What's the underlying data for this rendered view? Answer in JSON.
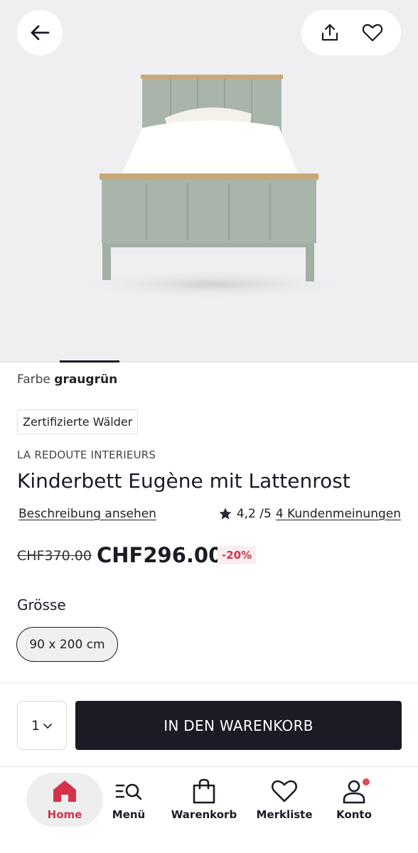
{
  "product": {
    "color_label": "Farbe",
    "color_value": "graugrün",
    "cert_badge": "Zertifizierte Wälder",
    "brand": "LA REDOUTE INTERIEURS",
    "title": "Kinderbett Eugène mit Lattenrost",
    "description_link": "Beschreibung ansehen",
    "rating": "4,2 /5",
    "reviews_link": "4 Kundenmeinungen",
    "old_price": "CHF370.00",
    "new_price": "CHF296.00",
    "discount": "-20%",
    "size_label": "Grösse",
    "size_selected": "90 x 200 cm",
    "quantity": "1",
    "add_to_cart": "IN DEN WARENKORB"
  },
  "nav": {
    "home": "Home",
    "menu": "Menü",
    "cart": "Warenkorb",
    "wishlist": "Merkliste",
    "account": "Konto"
  },
  "colors": {
    "accent": "#d6314a",
    "dark": "#1b1b26",
    "bed_green": "#a9b4ab"
  }
}
